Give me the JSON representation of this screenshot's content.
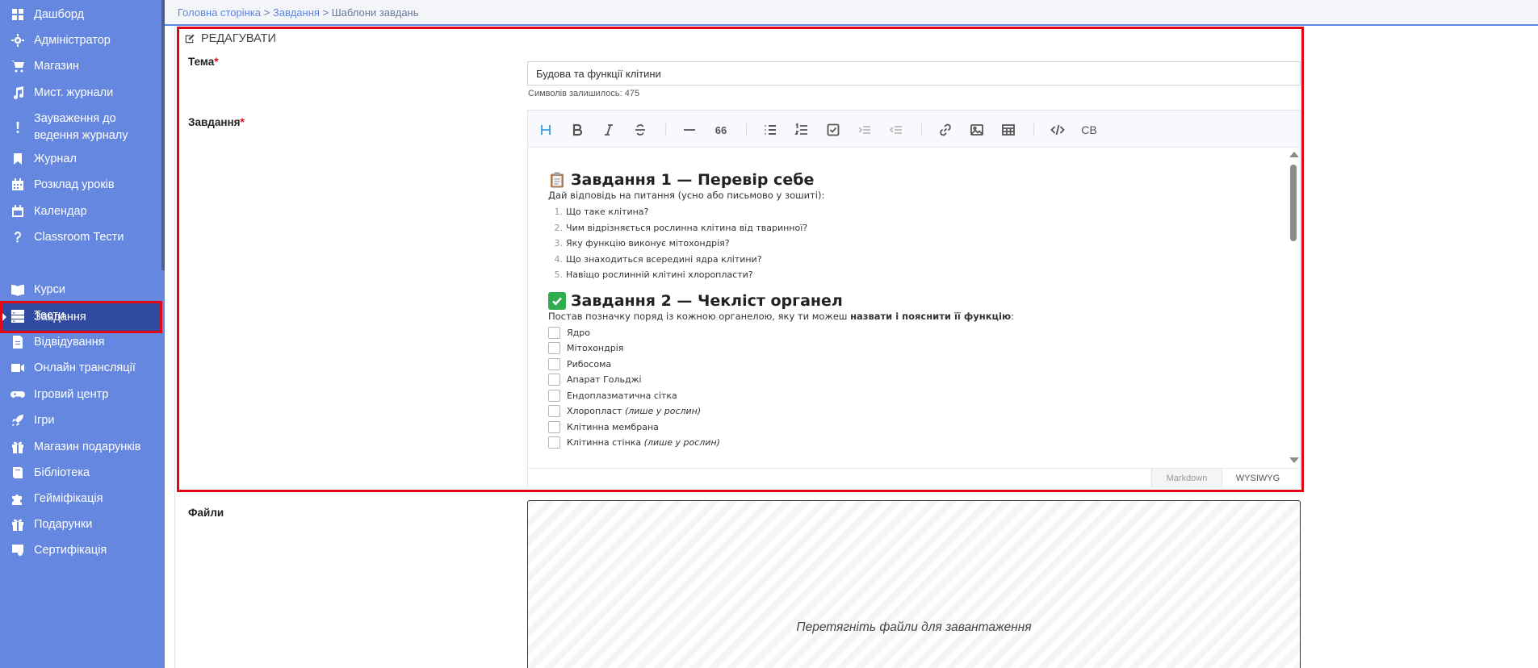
{
  "sidebar": {
    "items": [
      {
        "label": "Дашборд",
        "icon": "dashboard-icon"
      },
      {
        "label": "Адміністратор",
        "icon": "gear-icon"
      },
      {
        "label": "Магазин",
        "icon": "cart-icon"
      },
      {
        "label": "Мист. журнали",
        "icon": "music-icon"
      },
      {
        "label": "Зауваження до ведення журналу",
        "icon": "exclamation-icon"
      },
      {
        "label": "Журнал",
        "icon": "bookmark-icon"
      },
      {
        "label": "Розклад уроків",
        "icon": "calendar-grid-icon"
      },
      {
        "label": "Календар",
        "icon": "calendar-icon"
      },
      {
        "label": "Classroom Тести",
        "icon": "question-icon"
      },
      {
        "label": "Завдання",
        "icon": "tasks-icon",
        "active": true
      },
      {
        "label": "Курси",
        "icon": "book-open-icon"
      },
      {
        "label": "Тести",
        "icon": "list-icon"
      },
      {
        "label": "Відвідування",
        "icon": "attendance-icon"
      },
      {
        "label": "Онлайн трансляції",
        "icon": "video-icon"
      },
      {
        "label": "Ігровий центр",
        "icon": "gamepad-icon"
      },
      {
        "label": "Ігри",
        "icon": "rocket-icon"
      },
      {
        "label": "Магазин подарунків",
        "icon": "gift-icon"
      },
      {
        "label": "Бібліотека",
        "icon": "library-icon"
      },
      {
        "label": "Гейміфікація",
        "icon": "puzzle-icon"
      },
      {
        "label": "Подарунки",
        "icon": "gift-icon"
      },
      {
        "label": "Сертифікація",
        "icon": "certificate-icon"
      }
    ]
  },
  "breadcrumb": {
    "home": "Головна сторінка",
    "sep1": " > ",
    "tasks": "Завдання",
    "sep2": " > ",
    "current": "Шаблони завдань"
  },
  "form": {
    "title": "РЕДАГУВАТИ",
    "topic_label": "Тема",
    "required_mark": "*",
    "topic_value": "Будова та функції клітини",
    "chars_left": "Символів залишилось: 475",
    "task_label": "Завдання",
    "files_label": "Файли",
    "files_drop_text": "Перетягніть файли для завантаження"
  },
  "toolbar": {
    "strike_symbol": "S",
    "quote_symbol": "66",
    "cb_label": "CB"
  },
  "editor": {
    "task1": {
      "emoji": "📋",
      "heading": "Завдання 1 — Перевір себе",
      "intro": "Дай відповідь на питання (усно або письмово у зошиті):",
      "questions": [
        "Що таке клітина?",
        "Чим відрізняється рослинна клітина від тваринної?",
        "Яку функцію виконує мітохондрія?",
        "Що знаходиться всередині ядра клітини?",
        "Навіщо рослинній клітині хлоропласти?"
      ]
    },
    "task2": {
      "emoji": "✅",
      "heading": "Завдання 2 — Чекліст органел",
      "intro_start": "Постав позначку поряд із кожною органелою, яку ти можеш ",
      "intro_bold": "назвати і пояснити її функцію",
      "intro_end": ":",
      "organelles": [
        {
          "name": "Ядро",
          "note": ""
        },
        {
          "name": "Мітохондрія",
          "note": ""
        },
        {
          "name": "Рибосома",
          "note": ""
        },
        {
          "name": "Апарат Гольджі",
          "note": ""
        },
        {
          "name": "Ендоплазматична сітка",
          "note": ""
        },
        {
          "name": "Хлоропласт ",
          "note": "(лише у рослин)"
        },
        {
          "name": "Клітинна мембрана",
          "note": ""
        },
        {
          "name": "Клітинна стінка ",
          "note": "(лише у рослин)"
        }
      ]
    },
    "modes": [
      "Markdown",
      "WYSIWYG"
    ]
  },
  "colors": {
    "sidebar_bg": "#6587e0",
    "sidebar_active": "#2f4aa0",
    "highlight_red": "#e30613",
    "accent_blue": "#5b86e5",
    "check_green": "#2eae4e"
  }
}
